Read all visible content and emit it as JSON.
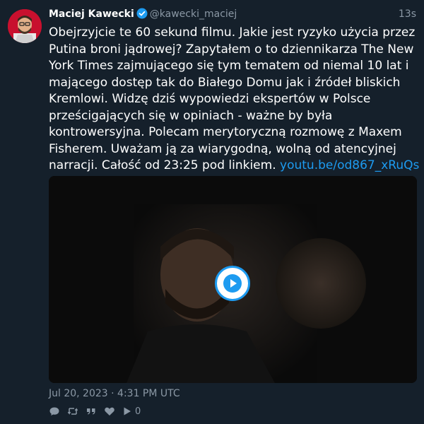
{
  "author": {
    "name": "Maciej Kawecki",
    "handle": "@kawecki_maciej",
    "verified": true
  },
  "timestamp_relative": "13s",
  "text_main": "Obejrzyjcie te 60 sekund filmu. Jakie jest ryzyko użycia przez Putina broni jądrowej? Zapytałem o to dziennikarza The New York Times zajmującego się tym tematem od niemal 10 lat i mającego dostęp tak do Białego Domu jak i źródeł bliskich Kremlowi. Widzę dziś wypowiedzi ekspertów w Polsce prześcigających się w opiniach - ważne by była kontrowersyjna. Polecam merytoryczną rozmowę z Maxem Fisherem. Uważam ją za wiarygodną, wolną od atencyjnej narracji. Całość od 23:25 pod linkiem. ",
  "text_link": "youtu.be/od867_xRuQs",
  "date": "Jul 20, 2023 · 4:31 PM UTC",
  "actions": {
    "reply_icon": "reply-icon",
    "retweet_icon": "retweet-icon",
    "quote_icon": "quote-icon",
    "like_icon": "heart-icon",
    "views_icon": "play-icon",
    "views_count": "0"
  },
  "colors": {
    "background": "#15202b",
    "accent": "#1d9bf0",
    "muted": "#8b98a5"
  }
}
